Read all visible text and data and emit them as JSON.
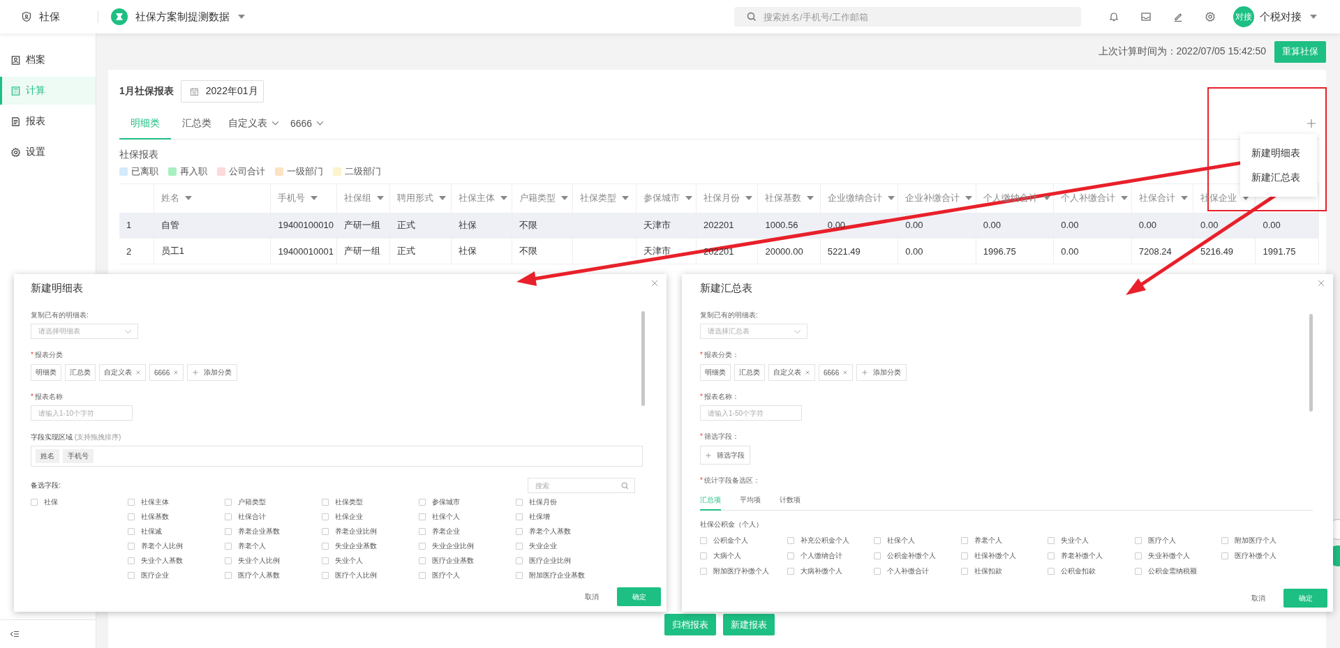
{
  "topbar": {
    "module": "社保",
    "project": "社保方案制提测数据",
    "search_placeholder": "搜索姓名/手机号/工作邮箱",
    "avatar": "对接",
    "user": "个税对接"
  },
  "sidebar": {
    "items": [
      {
        "label": "档案",
        "kind": "profile",
        "selected": false
      },
      {
        "label": "计算",
        "kind": "calc",
        "selected": true
      },
      {
        "label": "报表",
        "kind": "report",
        "selected": false
      },
      {
        "label": "设置",
        "kind": "gear",
        "selected": false
      }
    ]
  },
  "header": {
    "last_calc": "上次计算时间为：2022/07/05 15:42:50",
    "recalc_button": "重算社保"
  },
  "report": {
    "title": "1月社保报表",
    "month": "2022年01月",
    "tabs": [
      {
        "label": "明细类",
        "selected": true,
        "dropdown": false
      },
      {
        "label": "汇总类",
        "selected": false,
        "dropdown": false
      },
      {
        "label": "自定义表",
        "selected": false,
        "dropdown": true
      },
      {
        "label": "6666",
        "selected": false,
        "dropdown": true
      }
    ],
    "table_title": "社保报表",
    "legend": [
      {
        "label": "已离职",
        "color": "#d3eafb"
      },
      {
        "label": "再入职",
        "color": "#a8f0c2"
      },
      {
        "label": "公司合计",
        "color": "#fdd9d9"
      },
      {
        "label": "一级部门",
        "color": "#fde3c4"
      },
      {
        "label": "二级部门",
        "color": "#fdf3cc"
      }
    ],
    "columns": [
      "姓名",
      "手机号",
      "社保组",
      "聘用形式",
      "社保主体",
      "户籍类型",
      "社保类型",
      "参保城市",
      "社保月份",
      "社保基数",
      "企业缴纳合计",
      "企业补缴合计",
      "个人缴纳合计",
      "个人补缴合计",
      "社保合计",
      "社保企业"
    ],
    "rows": [
      {
        "highlighted": true,
        "index": "1",
        "cells": [
          "自管",
          "19400100010",
          "产研一组",
          "正式",
          "社保",
          "不限",
          null,
          "天津市",
          "202201",
          "1000.56",
          "0.00",
          "0.00",
          "0.00",
          "0.00",
          "0.00",
          "0.00",
          "0.00"
        ]
      },
      {
        "highlighted": false,
        "index": "2",
        "cells": [
          "员工1",
          "19400010001",
          "产研一组",
          "正式",
          "社保",
          "不限",
          null,
          "天津市",
          "202201",
          "20000.00",
          "5221.49",
          "0.00",
          "1996.75",
          "0.00",
          "7208.24",
          "5216.49",
          "1991.75"
        ]
      }
    ]
  },
  "add_menu": {
    "items": [
      "新建明细表",
      "新建汇总表"
    ]
  },
  "footer_buttons": [
    "归档报表",
    "新建报表"
  ],
  "detail_dialog": {
    "title": "新建明细表",
    "required_mark": "*",
    "copy_label": "复制已有的明细表:",
    "copy_placeholder": "请选择明细表",
    "category_label": "报表分类",
    "categories": [
      {
        "label": "明细类",
        "removable": false
      },
      {
        "label": "汇总类",
        "removable": false
      },
      {
        "label": "自定义表",
        "removable": true
      },
      {
        "label": "6666",
        "removable": true
      }
    ],
    "add_category": "添加分类",
    "name_label": "报表名称",
    "name_placeholder": "请输入1-10个字符",
    "area_label": "字段实现区域",
    "area_hint": "(支持拖拽排序)",
    "chosen_fields": [
      "姓名",
      "手机号"
    ],
    "candidates_label": "备选字段:",
    "search_placeholder": "搜索",
    "lead_field": {
      "label": "社保",
      "checked": false
    },
    "fields": [
      {
        "label": "社保主体",
        "checked": false
      },
      {
        "label": "户籍类型",
        "checked": false
      },
      {
        "label": "社保类型",
        "checked": false
      },
      {
        "label": "参保城市",
        "checked": false
      },
      {
        "label": "社保月份",
        "checked": false
      },
      {
        "label": "社保基数",
        "checked": false
      },
      {
        "label": "社保合计",
        "checked": false
      },
      {
        "label": "社保企业",
        "checked": false
      },
      {
        "label": "社保个人",
        "checked": false
      },
      {
        "label": "社保增",
        "checked": false
      },
      {
        "label": "社保减",
        "checked": false
      },
      {
        "label": "养老企业基数",
        "checked": false
      },
      {
        "label": "养老企业比例",
        "checked": false
      },
      {
        "label": "养老企业",
        "checked": false
      },
      {
        "label": "养老个人基数",
        "checked": false
      },
      {
        "label": "养老个人比例",
        "checked": false
      },
      {
        "label": "养老个人",
        "checked": false
      },
      {
        "label": "失业企业基数",
        "checked": false
      },
      {
        "label": "失业企业比例",
        "checked": false
      },
      {
        "label": "失业企业",
        "checked": false
      },
      {
        "label": "失业个人基数",
        "checked": false
      },
      {
        "label": "失业个人比例",
        "checked": false
      },
      {
        "label": "失业个人",
        "checked": false
      },
      {
        "label": "医疗企业基数",
        "checked": false
      },
      {
        "label": "医疗企业比例",
        "checked": false
      },
      {
        "label": "医疗企业",
        "checked": false
      },
      {
        "label": "医疗个人基数",
        "checked": false
      },
      {
        "label": "医疗个人比例",
        "checked": false
      },
      {
        "label": "医疗个人",
        "checked": false
      },
      {
        "label": "附加医疗企业基数",
        "checked": false
      }
    ],
    "cancel": "取消",
    "confirm": "确定"
  },
  "summary_dialog": {
    "title": "新建汇总表",
    "required_mark": "*",
    "copy_label": "复制已有的明细表:",
    "copy_placeholder": "请选择汇总表",
    "category_label": "报表分类：",
    "categories": [
      {
        "label": "明细类",
        "removable": false
      },
      {
        "label": "汇总类",
        "removable": false
      },
      {
        "label": "自定义表",
        "removable": true
      },
      {
        "label": "6666",
        "removable": true
      }
    ],
    "add_category": "添加分类",
    "name_label": "报表名称：",
    "name_placeholder": "请输入1-50个字符",
    "filter_label": "筛选字段：",
    "filter_button": "筛选字段",
    "stats_label": "统计字段备选区：",
    "stat_tabs": [
      {
        "label": "汇总项",
        "selected": true
      },
      {
        "label": "平均项",
        "selected": false
      },
      {
        "label": "计数项",
        "selected": false
      }
    ],
    "group_title": "社保公积金（个人）",
    "fields": [
      {
        "label": "公积金个人",
        "checked": false
      },
      {
        "label": "补充公积金个人",
        "checked": false
      },
      {
        "label": "社保个人",
        "checked": false
      },
      {
        "label": "养老个人",
        "checked": false
      },
      {
        "label": "失业个人",
        "checked": false
      },
      {
        "label": "医疗个人",
        "checked": false
      },
      {
        "label": "附加医疗个人",
        "checked": false
      },
      {
        "label": "大病个人",
        "checked": false
      },
      {
        "label": "个人缴纳合计",
        "checked": false
      },
      {
        "label": "公积金补缴个人",
        "checked": false
      },
      {
        "label": "社保补缴个人",
        "checked": false
      },
      {
        "label": "养老补缴个人",
        "checked": false
      },
      {
        "label": "失业补缴个人",
        "checked": false
      },
      {
        "label": "医疗补缴个人",
        "checked": false
      },
      {
        "label": "附加医疗补缴个人",
        "checked": false
      },
      {
        "label": "大病补缴个人",
        "checked": false
      },
      {
        "label": "个人补缴合计",
        "checked": false
      },
      {
        "label": "社保扣款",
        "checked": false
      },
      {
        "label": "公积金扣款",
        "checked": false
      },
      {
        "label": "公积金需纳税额",
        "checked": false
      }
    ],
    "cancel": "取消",
    "confirm": "确定"
  }
}
